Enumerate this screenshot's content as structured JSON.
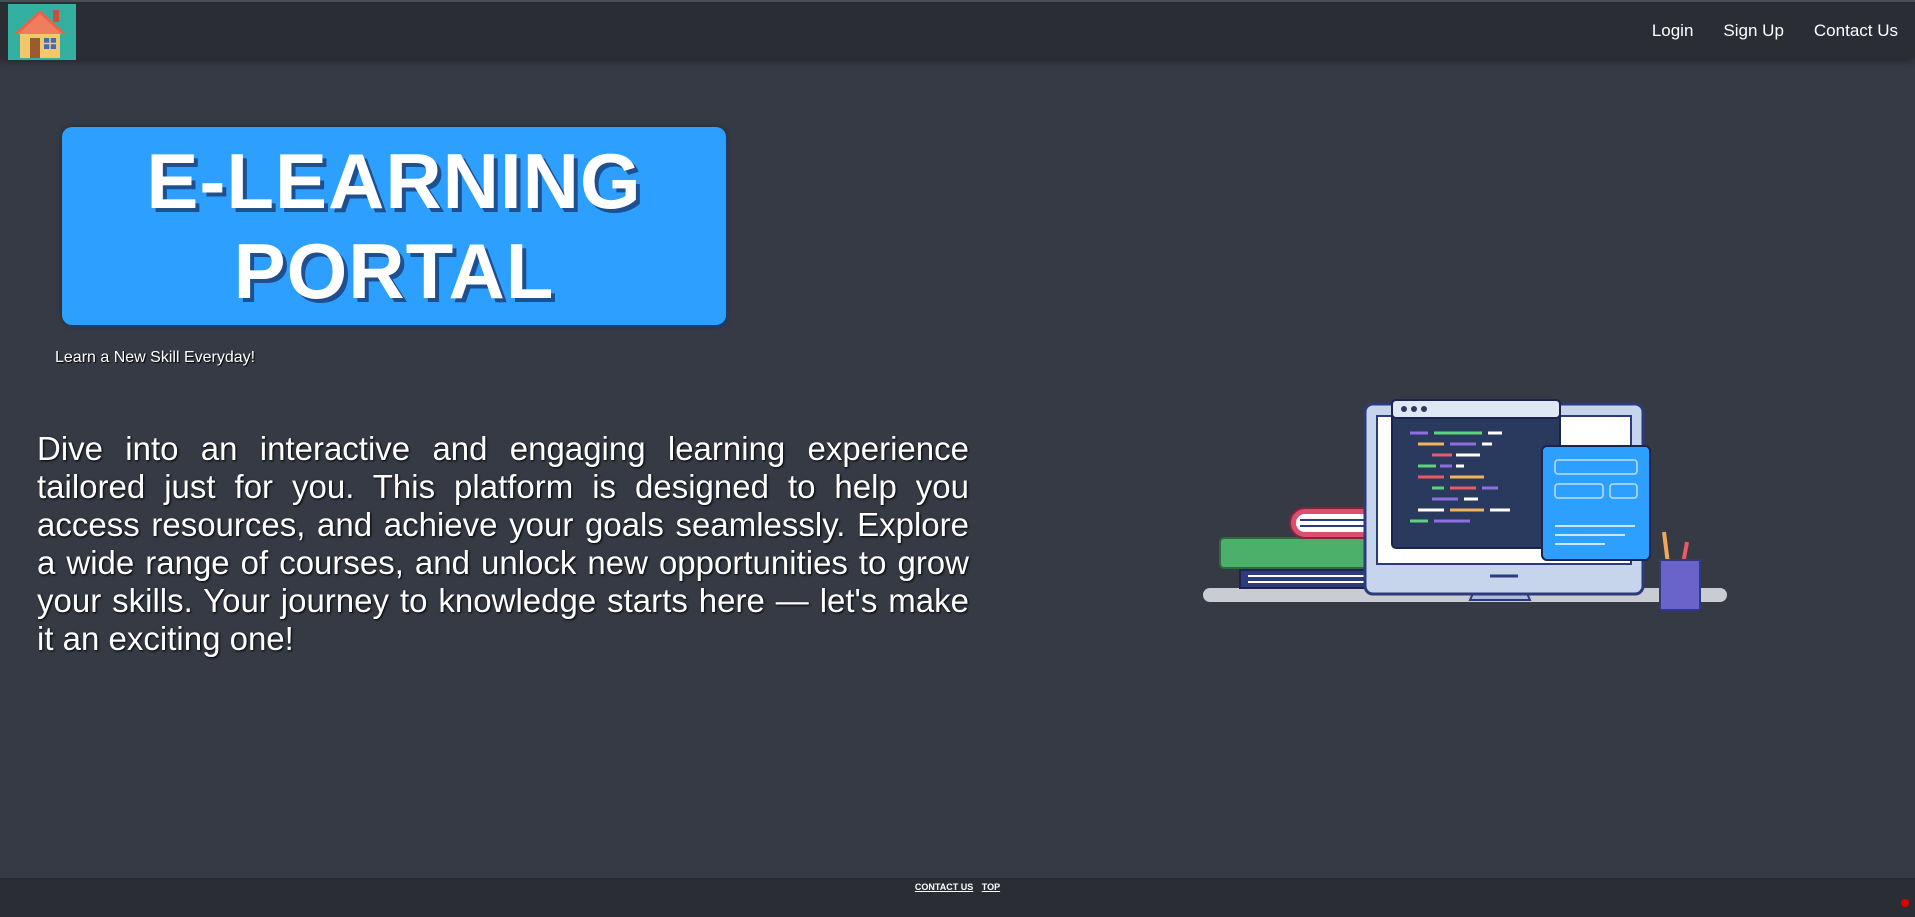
{
  "header": {
    "logo_icon": "house-icon",
    "nav": [
      {
        "label": "Login"
      },
      {
        "label": "Sign Up"
      },
      {
        "label": "Contact Us"
      }
    ]
  },
  "hero": {
    "title_line1": "E-LEARNING",
    "title_line2": "PORTAL",
    "tagline": "Learn a New Skill Everyday!",
    "intro": "Dive into an interactive and engaging learning experience tailored just for you. This platform is designed to help you access resources, and achieve your goals seamlessly. Explore a wide range of courses, and unlock new opportunities to grow your skills. Your journey to knowledge starts here — let's make it an exciting one!",
    "illustration_icon": "computer-desk-illustration"
  },
  "footer": {
    "contact_label": "CONTACT US",
    "top_label": "TOP"
  },
  "colors": {
    "background": "#353a44",
    "topbar": "#2a2d34",
    "accent": "#2c9fff",
    "title_shadow": "#1e4f8f"
  }
}
